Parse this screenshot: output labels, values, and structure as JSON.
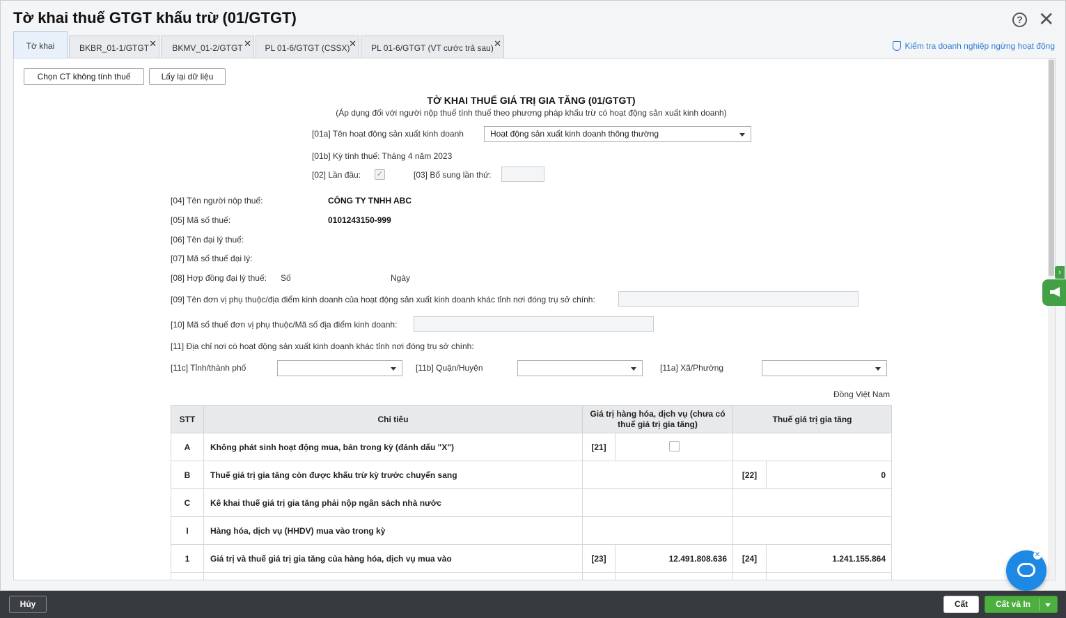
{
  "window": {
    "title": "Tờ khai thuế GTGT khấu trừ (01/GTGT)",
    "check_link": "Kiểm tra doanh nghiệp ngừng hoạt động"
  },
  "tabs": [
    {
      "label": "Tờ khai",
      "active": true
    },
    {
      "label": "BKBR_01-1/GTGT",
      "closable": true
    },
    {
      "label": "BKMV_01-2/GTGT",
      "closable": true
    },
    {
      "label": "PL 01-6/GTGT (CSSX)",
      "closable": true
    },
    {
      "label": "PL 01-6/GTGT (VT cước trả sau)",
      "closable": true
    }
  ],
  "toolbar": {
    "choose_btn": "Chọn CT không tính thuế",
    "reload_btn": "Lấy lại dữ liệu"
  },
  "form": {
    "title": "TỜ KHAI THUẾ GIÁ TRỊ GIA TĂNG (01/GTGT)",
    "subtitle": "(Áp dụng đối với người nộp thuế tính thuế theo phương pháp khấu trừ có hoạt động sản xuất kinh doanh)",
    "f01a_label": "[01a] Tên hoạt động sản xuất kinh doanh",
    "f01a_value": "Hoạt động sản xuất kinh doanh thông thường",
    "f01b": "[01b] Kỳ tính thuế: Tháng 4 năm 2023",
    "f02_label": "[02] Lần đầu:",
    "f03_label": "[03] Bổ sung lần thứ:",
    "f04_label": "[04] Tên người nộp thuế:",
    "f04_value": "CÔNG TY TNHH ABC",
    "f05_label": "[05] Mã số thuế:",
    "f05_value": "0101243150-999",
    "f06_label": "[06] Tên đại lý thuế:",
    "f07_label": "[07] Mã số thuế đại lý:",
    "f08_label": "[08] Hợp đồng đại lý thuế:",
    "f08_so": "Số",
    "f08_ngay": "Ngày",
    "f09_label": "[09] Tên đơn vị phụ thuộc/địa điểm kinh doanh của hoạt động sản xuất kinh doanh khác tỉnh nơi đóng trụ sở chính:",
    "f10_label": "[10] Mã số thuế đơn vị phụ thuộc/Mã số địa điểm kinh doanh:",
    "f11_label": "[11] Địa chỉ nơi có hoạt động sản xuất kinh doanh khác tỉnh nơi đóng trụ sở chính:",
    "f11c_label": "[11c] Tỉnh/thành phố",
    "f11b_label": "[11b] Quận/Huyện",
    "f11a_label": "[11a] Xã/Phường",
    "currency": "Đồng Việt Nam"
  },
  "table": {
    "headers": {
      "stt": "STT",
      "chitieu": "Chỉ tiêu",
      "giatri": "Giá trị hàng hóa, dịch vụ (chưa có thuế giá trị gia tăng)",
      "thue": "Thuế giá trị gia tăng"
    },
    "rows": [
      {
        "stt": "A",
        "chitieu": "Không phát sinh hoạt động mua, bán trong kỳ (đánh dấu \"X\")",
        "code1": "[21]"
      },
      {
        "stt": "B",
        "chitieu": "Thuế giá trị gia tăng còn được khấu trừ kỳ trước chuyển sang",
        "code2": "[22]",
        "val2": "0"
      },
      {
        "stt": "C",
        "chitieu": "Kê khai thuế giá trị gia tăng phải nộp ngân sách nhà nước"
      },
      {
        "stt": "I",
        "chitieu": "Hàng hóa, dịch vụ (HHDV) mua vào trong kỳ"
      },
      {
        "stt": "1",
        "chitieu": "Giá trị và thuế giá trị gia tăng của hàng hóa, dịch vụ mua vào",
        "code1": "[23]",
        "val1": "12.491.808.636",
        "code2": "[24]",
        "val2": "1.241.155.864"
      }
    ]
  },
  "bottombar": {
    "cancel": "Hủy",
    "save": "Cất",
    "save_print": "Cất và In"
  }
}
